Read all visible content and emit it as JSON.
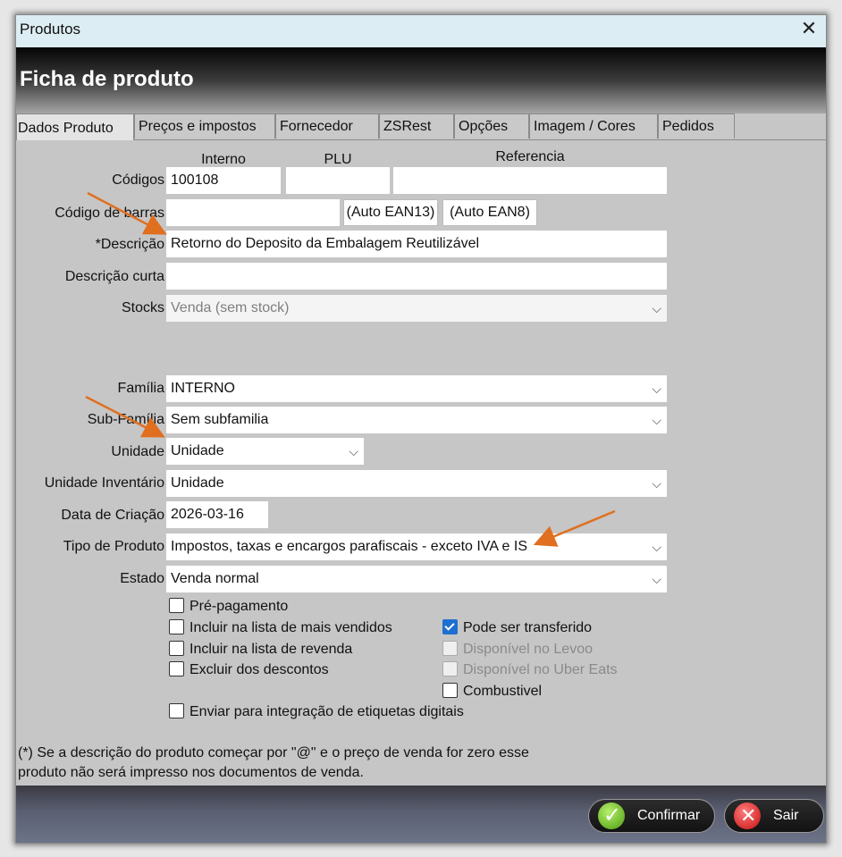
{
  "window": {
    "title": "Produtos",
    "close_glyph": "✕"
  },
  "header": {
    "title": "Ficha de produto"
  },
  "tabs": [
    "Dados Produto",
    "Preços e impostos",
    "Fornecedor",
    "ZSRest",
    "Opções",
    "Imagem / Cores",
    "Pedidos"
  ],
  "codes": {
    "label": "Códigos",
    "col_interno": "Interno",
    "col_plu": "PLU",
    "col_referencia": "Referencia",
    "interno": "100108",
    "plu": "",
    "referencia": ""
  },
  "barcode": {
    "label": "Código de barras",
    "value": "",
    "btn_ean13": "(Auto EAN13)",
    "btn_ean8": "(Auto EAN8)"
  },
  "descricao": {
    "label": "*Descrição",
    "value": "Retorno do Deposito da Embalagem Reutilizável"
  },
  "descricao_curta": {
    "label": "Descrição curta",
    "value": ""
  },
  "stocks": {
    "label": "Stocks",
    "value": "Venda (sem stock)"
  },
  "familia": {
    "label": "Família",
    "value": "INTERNO"
  },
  "subfamilia": {
    "label": "Sub-Família",
    "value": "Sem subfamilia"
  },
  "unidade": {
    "label": "Unidade",
    "value": "Unidade"
  },
  "unidade_inventario": {
    "label": "Unidade Inventário",
    "value": "Unidade"
  },
  "data_criacao": {
    "label": "Data de Criação",
    "value": "2026-03-16"
  },
  "tipo_produto": {
    "label": "Tipo de Produto",
    "value": "Impostos, taxas e encargos parafiscais - exceto IVA e IS"
  },
  "estado": {
    "label": "Estado",
    "value": "Venda normal"
  },
  "checkboxes": {
    "pre_pagamento": "Pré-pagamento",
    "mais_vendidos": "Incluir na lista de mais vendidos",
    "revenda": "Incluir na lista de revenda",
    "descontos": "Excluir dos descontos",
    "transferido": "Pode ser transferido",
    "levoo": "Disponível no Levoo",
    "uber": "Disponível no Uber Eats",
    "combustivel": "Combustivel",
    "etiquetas": "Enviar para integração de etiquetas digitais"
  },
  "note": {
    "line1": "(*) Se a descrição do produto começar por \"@\" e o preço de venda for zero  esse",
    "line2": "produto não será impresso nos documentos de venda."
  },
  "footer": {
    "confirm": "Confirmar",
    "exit": "Sair"
  },
  "colors": {
    "arrow": "#e06f1f",
    "checkbox_checked": "#1f6fd1",
    "header_top": "#050505",
    "titlebar": "#dcedf3"
  },
  "icons": {
    "close": "close-icon",
    "dropdown": "chevron-down-icon",
    "confirm": "check-circle-icon",
    "exit": "x-circle-icon"
  }
}
